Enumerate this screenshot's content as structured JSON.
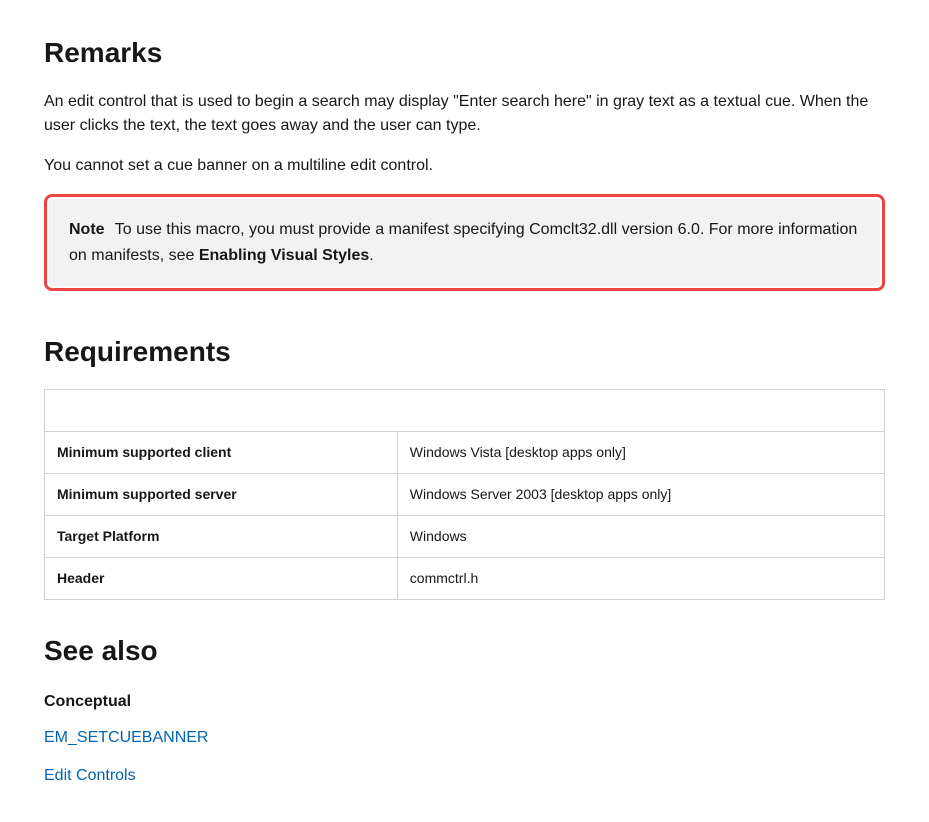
{
  "remarks": {
    "heading": "Remarks",
    "para1": "An edit control that is used to begin a search may display \"Enter search here\" in gray text as a textual cue. When the user clicks the text, the text goes away and the user can type.",
    "para2": "You cannot set a cue banner on a multiline edit control.",
    "note": {
      "label": "Note",
      "text1": "To use this macro, you must provide a manifest specifying Comclt32.dll version 6.0. For more information on manifests, see ",
      "link_text": "Enabling Visual Styles",
      "text2": "."
    }
  },
  "requirements": {
    "heading": "Requirements",
    "rows": [
      {
        "label": "Minimum supported client",
        "value": "Windows Vista [desktop apps only]"
      },
      {
        "label": "Minimum supported server",
        "value": "Windows Server 2003 [desktop apps only]"
      },
      {
        "label": "Target Platform",
        "value": "Windows"
      },
      {
        "label": "Header",
        "value": "commctrl.h"
      }
    ]
  },
  "see_also": {
    "heading": "See also",
    "subheading": "Conceptual",
    "links": [
      {
        "text": "EM_SETCUEBANNER"
      },
      {
        "text": "Edit Controls"
      }
    ]
  }
}
